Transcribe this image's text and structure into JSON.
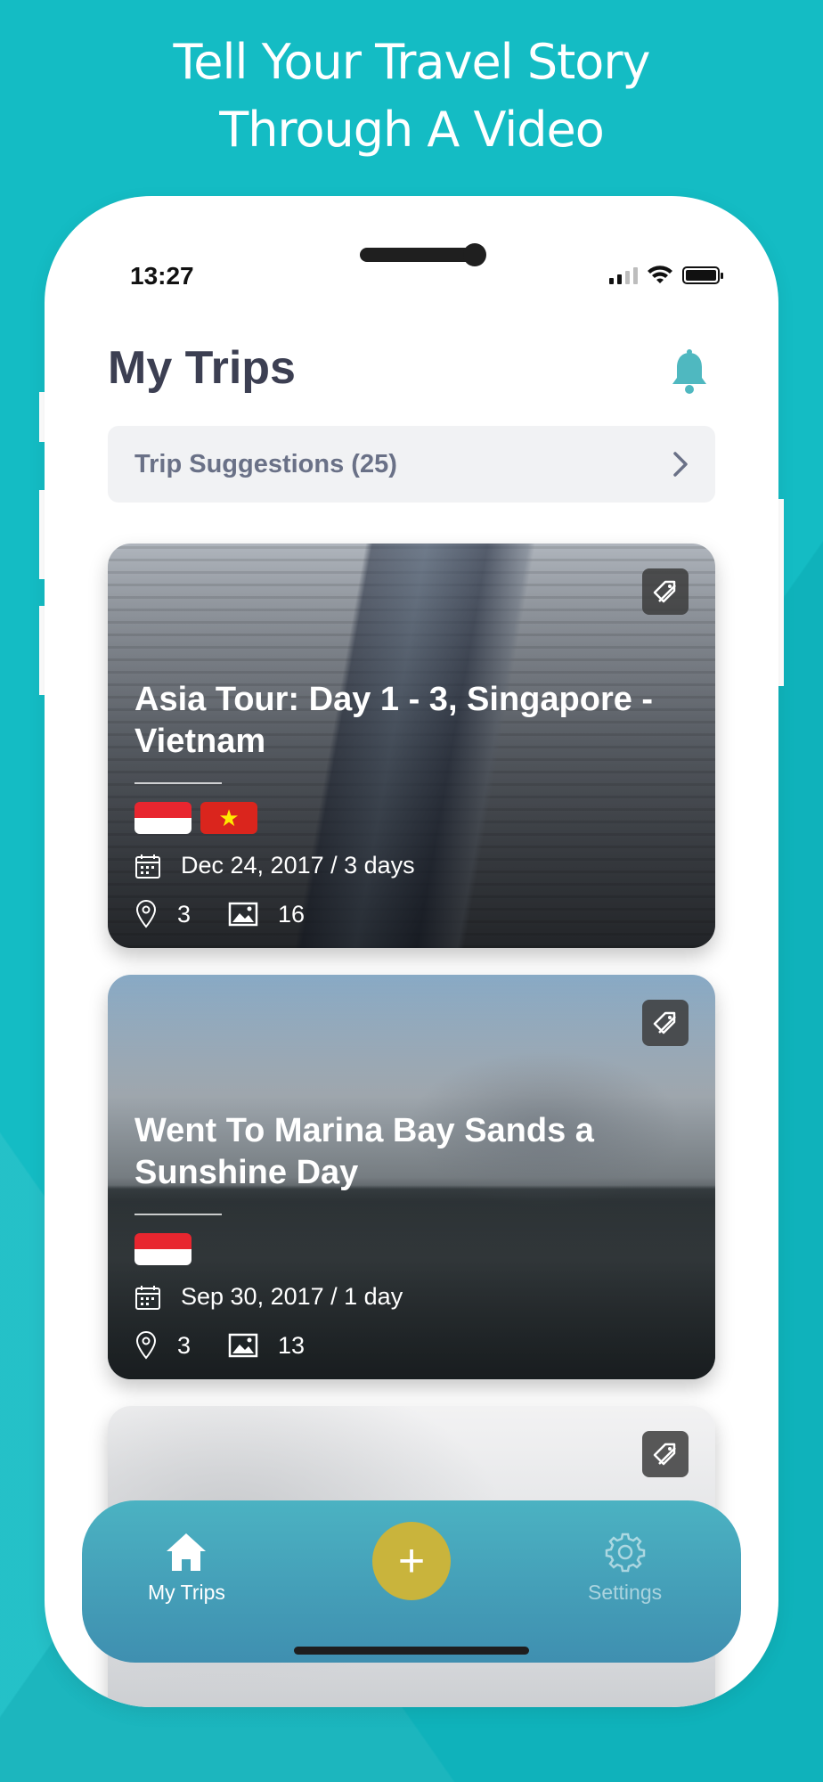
{
  "promo": {
    "headline_line1": "Tell Your Travel Story",
    "headline_line2": "Through A Video"
  },
  "status_bar": {
    "time": "13:27"
  },
  "header": {
    "title": "My Trips",
    "bell_icon": "bell-icon",
    "accent_color": "#4fb8c0"
  },
  "suggestions": {
    "label": "Trip Suggestions (25)"
  },
  "trips": [
    {
      "title": "Asia Tour: Day 1 - 3, Singapore - Vietnam",
      "flags": [
        "Singapore",
        "Vietnam"
      ],
      "date": "Dec 24, 2017 / 3 days",
      "places": "3",
      "photos": "16"
    },
    {
      "title": "Went To Marina Bay Sands a Sunshine Day",
      "flags": [
        "Singapore"
      ],
      "date": "Sep 30, 2017 / 1 day",
      "places": "3",
      "photos": "13"
    },
    {
      "title": "",
      "flags": [],
      "date": "",
      "places": "",
      "photos": ""
    }
  ],
  "tabbar": {
    "my_trips": "My Trips",
    "add": "+",
    "settings": "Settings",
    "fab_color": "#c9b43c"
  }
}
